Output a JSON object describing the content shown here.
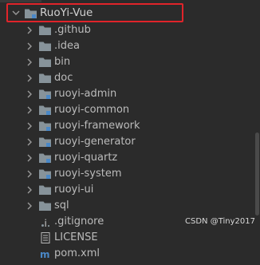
{
  "tree": {
    "root": {
      "label": "RuoYi-Vue",
      "icon": "module-folder-icon"
    },
    "items": [
      {
        "label": ".github",
        "icon": "folder-icon"
      },
      {
        "label": ".idea",
        "icon": "folder-icon"
      },
      {
        "label": "bin",
        "icon": "folder-icon"
      },
      {
        "label": "doc",
        "icon": "folder-icon"
      },
      {
        "label": "ruoyi-admin",
        "icon": "module-folder-icon"
      },
      {
        "label": "ruoyi-common",
        "icon": "module-folder-icon"
      },
      {
        "label": "ruoyi-framework",
        "icon": "module-folder-icon"
      },
      {
        "label": "ruoyi-generator",
        "icon": "module-folder-icon"
      },
      {
        "label": "ruoyi-quartz",
        "icon": "module-folder-icon"
      },
      {
        "label": "ruoyi-system",
        "icon": "module-folder-icon"
      },
      {
        "label": "ruoyi-ui",
        "icon": "folder-icon"
      },
      {
        "label": "sql",
        "icon": "folder-icon"
      },
      {
        "label": ".gitignore",
        "icon": "gitignore-file-icon"
      },
      {
        "label": "LICENSE",
        "icon": "text-file-icon"
      },
      {
        "label": "pom.xml",
        "icon": "maven-file-icon"
      }
    ]
  },
  "watermark": "CSDN @Tiny2017",
  "colors": {
    "background": "#2b2b2b",
    "text": "#bbbbbb",
    "folder": "#87939a",
    "module_square": "#4a88c7",
    "highlight": "#e0242a"
  }
}
